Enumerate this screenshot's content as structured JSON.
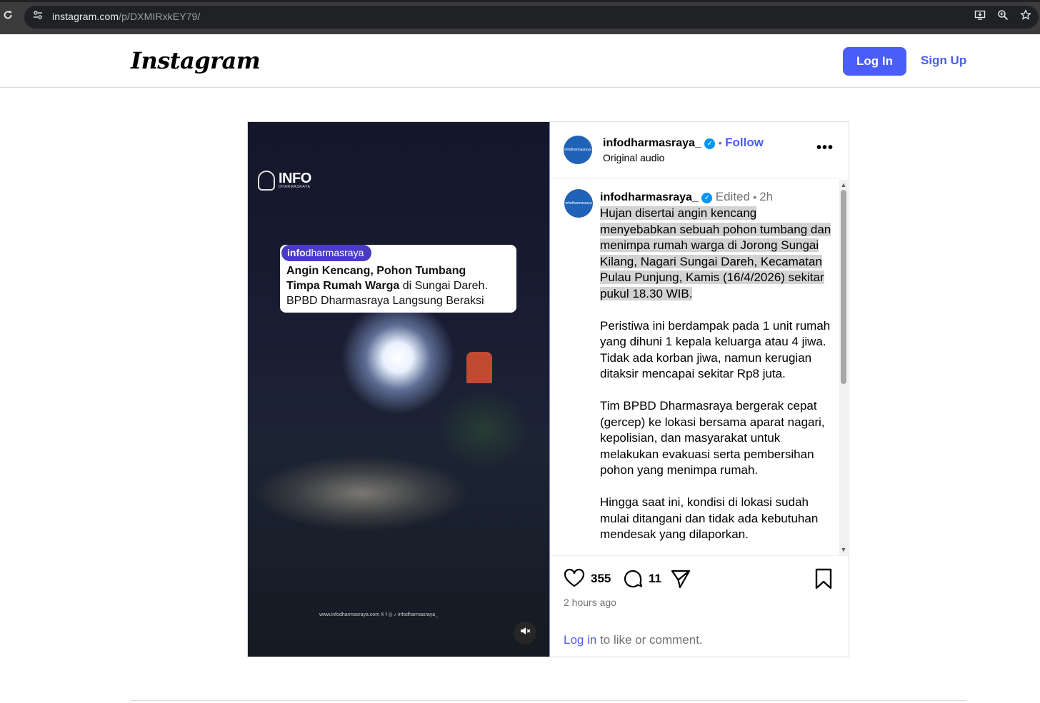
{
  "browser": {
    "url_host": "instagram.com",
    "url_path": "/p/DXMIRxkEY79/",
    "icons": [
      "reload-icon",
      "site-info-icon",
      "install-app-icon",
      "zoom-icon",
      "bookmark-star-icon"
    ]
  },
  "header": {
    "logo": "Instagram",
    "login_label": "Log In",
    "signup_label": "Sign Up",
    "accent_color": "#4a5df9"
  },
  "media": {
    "watermark_title": "INFO",
    "watermark_sub": "DHARMASRAYA",
    "pill_bold": "info",
    "pill_rest": "dharmasraya",
    "headline_bold_1": "Angin Kencang, Pohon Tumbang",
    "headline_bold_2": "Timpa Rumah Warga",
    "headline_rest_2": " di Sungai Dareh.",
    "headline_line_3": "BPBD Dharmasraya Langsung Beraksi",
    "footer_text": "www.infodharmasraya.com     X f ◎ ♪ infodharmasraya_",
    "mute_icon": "speaker-muted-icon"
  },
  "post": {
    "username": "infodharmasraya_",
    "follow_label": "Follow",
    "audio": "Original audio",
    "more_label": "•••",
    "avatar_text": "infodharmasraya",
    "caption_meta_edited": "Edited",
    "caption_meta_time": "2h",
    "caption_highlighted": "Hujan disertai angin kencang menyebabkan sebuah pohon tumbang dan menimpa rumah warga di Jorong Sungai Kilang, Nagari Sungai Dareh, Kecamatan Pulau Punjung, Kamis (16/4/2026) sekitar pukul 18.30 WIB.",
    "paragraphs": [
      "Peristiwa ini berdampak pada 1 unit rumah yang dihuni 1 kepala keluarga atau 4 jiwa. Tidak ada korban jiwa, namun kerugian ditaksir mencapai sekitar Rp8 juta.",
      "Tim BPBD Dharmasraya bergerak cepat (gercep) ke lokasi bersama aparat nagari, kepolisian, dan masyarakat untuk melakukan evakuasi serta pembersihan pohon yang menimpa rumah.",
      "Hingga saat ini, kondisi di lokasi sudah mulai ditangani dan tidak ada kebutuhan mendesak yang dilaporkan."
    ],
    "likes": "355",
    "comments": "11",
    "posted_ago": "2 hours ago",
    "login_link": "Log in",
    "login_rest": " to like or comment."
  }
}
